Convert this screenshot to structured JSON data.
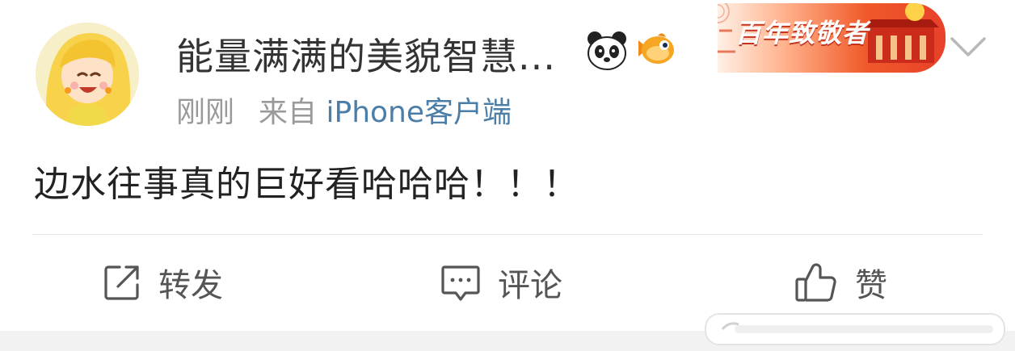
{
  "post": {
    "author": {
      "name": "能量满满的美貌智慧...",
      "avatar_icon": "cartoon-girl-avatar",
      "badges": [
        "panda-badge-icon",
        "goldfish-badge-icon"
      ]
    },
    "banner": {
      "text": "百年致敬者",
      "icon": "red-building-emblem"
    },
    "meta": {
      "time": "刚刚",
      "source_prefix": "来自",
      "source_client": "iPhone客户端"
    },
    "content": "边水往事真的巨好看哈哈哈！！！",
    "actions": {
      "repost_label": "转发",
      "comment_label": "评论",
      "like_label": "赞"
    }
  },
  "colors": {
    "text_primary": "#333333",
    "text_secondary": "#999999",
    "link": "#4a7ea8",
    "banner_red": "#e8402a"
  }
}
